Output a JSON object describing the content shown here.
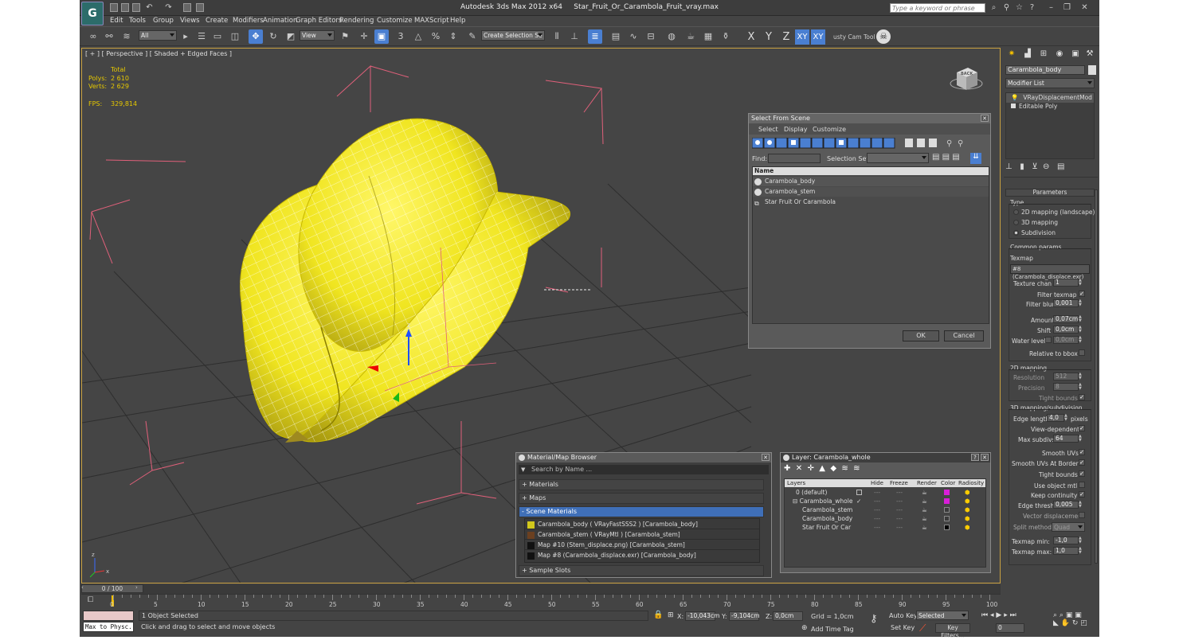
{
  "title": {
    "app": "Autodesk 3ds Max  2012 x64",
    "file": "Star_Fruit_Or_Carambola_Fruit_vray.max",
    "search_placeholder": "Type a keyword or phrase"
  },
  "menu": [
    "Edit",
    "Tools",
    "Group",
    "Views",
    "Create",
    "Modifiers",
    "Animation",
    "Graph Editors",
    "Rendering",
    "Customize",
    "MAXScript",
    "Help"
  ],
  "toolbar": {
    "filter_value": "All",
    "refcoord_value": "View",
    "selection_set_placeholder": "Create Selection Se",
    "axes": [
      "X",
      "Y",
      "Z",
      "XY",
      "XY"
    ],
    "cam_tool": "usty Cam Tool v"
  },
  "viewport": {
    "label": "[ + ] [ Perspective ] [ Shaded + Edged Faces ]",
    "stats": {
      "total_header": "Total",
      "polys_label": "Polys:",
      "polys_value": "2 610",
      "verts_label": "Verts:",
      "verts_value": "2 629",
      "fps_label": "FPS:",
      "fps_value": "329,814"
    },
    "viewcube_label": "BACK"
  },
  "select_from_scene": {
    "title": "Select From Scene",
    "menus": [
      "Select",
      "Display",
      "Customize"
    ],
    "find_label": "Find:",
    "selection_set_label": "Selection Set:",
    "column_name": "Name",
    "items": [
      "Carambola_body",
      "Carambola_stem",
      "Star Fruit Or Carambola"
    ],
    "ok_label": "OK",
    "cancel_label": "Cancel"
  },
  "material_browser": {
    "title": "Material/Map Browser",
    "search_placeholder": "Search by Name ...",
    "sections": [
      "+ Materials",
      "+ Maps",
      "- Scene Materials"
    ],
    "scene_materials": [
      "Carambola_body  ( VRayFastSSS2 )  [Carambola_body]",
      "Carambola_stem  ( VRayMtl )  [Carambola_stem]",
      "Map #10 (Stem_displace.png)  [Carambola_stem]",
      "Map #8 (Carambola_displace.exr)  [Carambola_body]"
    ],
    "sample_slots": "+ Sample Slots"
  },
  "layer_dialog": {
    "title": "Layer: Carambola_whole",
    "help_label": "?",
    "columns": [
      "Layers",
      "Hide",
      "Freeze",
      "Render",
      "Color",
      "Radiosity"
    ],
    "rows": [
      {
        "name": "0 (default)",
        "color": "#d81ed8"
      },
      {
        "name": "Carambola_whole",
        "color": "#d81ed8"
      },
      {
        "name": "Carambola_stem",
        "color": "#3a3a3a"
      },
      {
        "name": "Carambola_body",
        "color": "#3a3a3a"
      },
      {
        "name": "Star Fruit Or Car",
        "color": "#000000"
      }
    ]
  },
  "command_panel": {
    "object_name": "Carambola_body",
    "modifier_list": "Modifier List",
    "stack": [
      "VRayDisplacementMod",
      "Editable Poly"
    ],
    "parameters_title": "Parameters",
    "type_label": "Type",
    "types": [
      "2D mapping (landscape)",
      "3D mapping",
      "Subdivision"
    ],
    "common_params": "Common params",
    "texmap_label": "Texmap",
    "texmap_value": "#8 (Carambola_displace.exr)",
    "texture_chan_label": "Texture chan",
    "texture_chan_value": "1",
    "filter_texmap_label": "Filter texmap",
    "filter_blur_label": "Filter blur",
    "filter_blur_value": "0,001",
    "amount_label": "Amount",
    "amount_value": "0,07cm",
    "shift_label": "Shift",
    "shift_value": "0,0cm",
    "water_level_label": "Water level",
    "water_level_value": "0,0cm",
    "relative_bbox_label": "Relative to bbox",
    "mapping2d_title": "2D mapping",
    "resolution_label": "Resolution",
    "resolution_value": "512",
    "precision_label": "Precision",
    "precision_value": "8",
    "tight_bounds_label": "Tight bounds",
    "subdiv_title": "3D mapping/subdivision",
    "edge_length_label": "Edge length",
    "edge_length_value": "4,0",
    "pixels_label": "pixels",
    "view_dependent_label": "View-dependent",
    "max_subdivs_label": "Max subdivs",
    "max_subdivs_value": "64",
    "smooth_uvs_label": "Smooth UVs",
    "smooth_uvs_borders_label": "Smooth UVs At Borders",
    "tight_bounds2_label": "Tight bounds",
    "use_object_mtl_label": "Use object mtl",
    "keep_continuity_label": "Keep continuity",
    "edge_thresh_label": "Edge thresh",
    "edge_thresh_value": "0,005",
    "vector_disp_label": "Vector displacement",
    "split_method_label": "Split method",
    "split_method_value": "Quad",
    "texmap_min_label": "Texmap min:",
    "texmap_min_value": "-1,0",
    "texmap_max_label": "Texmap max:",
    "texmap_max_value": "1,0"
  },
  "timeline": {
    "frame_label": "0 / 100",
    "ticks": [
      "0",
      "5",
      "10",
      "15",
      "20",
      "25",
      "30",
      "35",
      "40",
      "45",
      "50",
      "55",
      "60",
      "65",
      "70",
      "75",
      "80",
      "85",
      "90",
      "95",
      "100"
    ]
  },
  "status": {
    "script_label": "Max to Physc.",
    "selected": "1 Object Selected",
    "prompt": "Click and drag to select and move objects",
    "x_label": "X:",
    "x_value": "-10,043cm",
    "y_label": "Y:",
    "y_value": "-9,104cm",
    "z_label": "Z:",
    "z_value": "0,0cm",
    "grid": "Grid = 1,0cm",
    "add_time_tag": "Add Time Tag",
    "auto_key": "Auto Key",
    "set_key": "Set Key",
    "selected_dd": "Selected",
    "key_filters": "Key Filters...",
    "frame_value": "0"
  }
}
